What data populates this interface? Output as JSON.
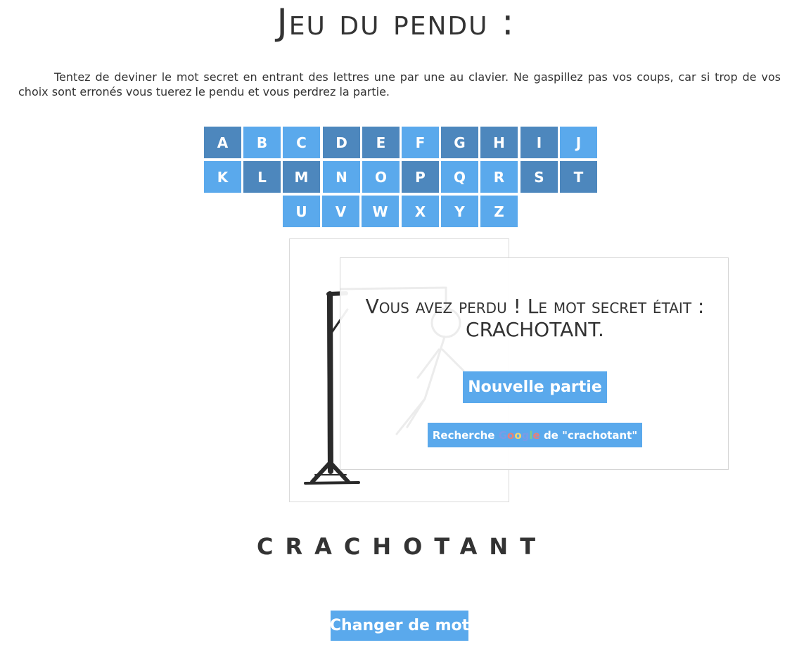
{
  "header": {
    "title": "Jeu du pendu :"
  },
  "intro": {
    "text": "Tentez de deviner le mot secret en entrant des lettres une par une au clavier. Ne gaspillez pas vos coups, car si trop de vos choix sont erronés vous tuerez le pendu et vous perdrez la partie."
  },
  "keyboard": {
    "rows": [
      [
        {
          "letter": "A",
          "used": true
        },
        {
          "letter": "B",
          "used": false
        },
        {
          "letter": "C",
          "used": false
        },
        {
          "letter": "D",
          "used": true
        },
        {
          "letter": "E",
          "used": true
        },
        {
          "letter": "F",
          "used": false
        },
        {
          "letter": "G",
          "used": true
        },
        {
          "letter": "H",
          "used": true
        },
        {
          "letter": "I",
          "used": true
        },
        {
          "letter": "J",
          "used": false
        }
      ],
      [
        {
          "letter": "K",
          "used": false
        },
        {
          "letter": "L",
          "used": true
        },
        {
          "letter": "M",
          "used": true
        },
        {
          "letter": "N",
          "used": false
        },
        {
          "letter": "O",
          "used": false
        },
        {
          "letter": "P",
          "used": true
        },
        {
          "letter": "Q",
          "used": false
        },
        {
          "letter": "R",
          "used": false
        },
        {
          "letter": "S",
          "used": true
        },
        {
          "letter": "T",
          "used": true
        }
      ],
      [
        {
          "letter": "U",
          "used": false
        },
        {
          "letter": "V",
          "used": false
        },
        {
          "letter": "W",
          "used": false
        },
        {
          "letter": "X",
          "used": false
        },
        {
          "letter": "Y",
          "used": false
        },
        {
          "letter": "Z",
          "used": false
        }
      ]
    ],
    "colors": {
      "used": "#4d87bd",
      "unused": "#5aa9ec"
    }
  },
  "dialog": {
    "message": "Vous avez perdu ! Le mot secret était : CRACHOTANT.",
    "new_game_label": "Nouvelle partie",
    "search_prefix": "Recherche ",
    "search_brand": "Google",
    "search_suffix": " de \"crachotant\""
  },
  "word": {
    "revealed": "CRACHOTANT"
  },
  "footer": {
    "change_word_label": "Changer de mot"
  },
  "colors": {
    "accent": "#5aa9ec",
    "text": "#333333"
  }
}
